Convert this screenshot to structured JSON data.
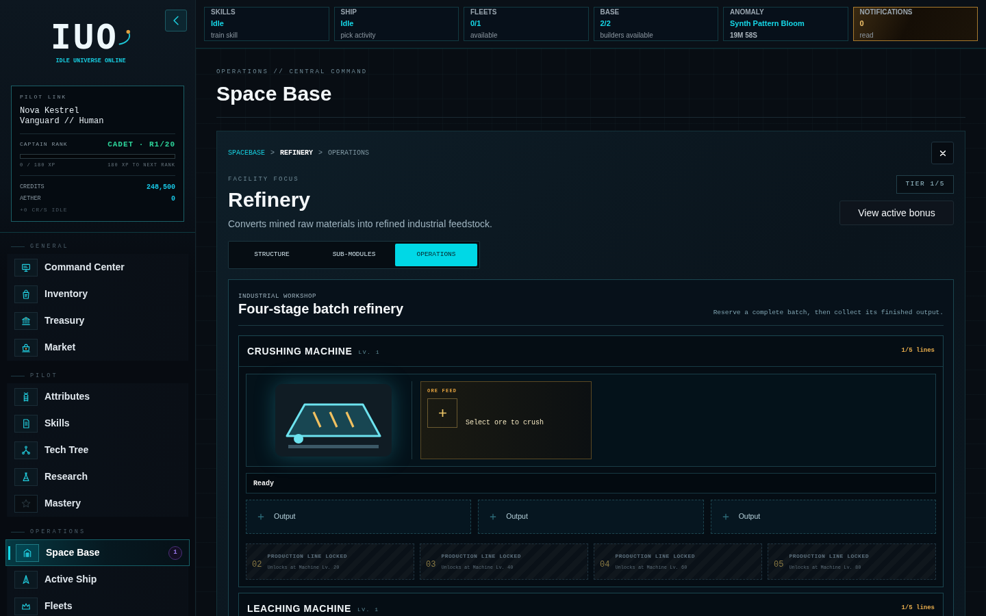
{
  "sidebar": {
    "logo": {
      "wordmark": "IUO",
      "tagline": "IDLE UNIVERSE ONLINE"
    },
    "pilot": {
      "label": "PILOT LINK",
      "name": "Nova Kestrel",
      "class": "Vanguard // Human",
      "rank_label": "CAPTAIN RANK",
      "rank": "CADET · R1/20",
      "xp": {
        "level": 0,
        "current": "0 / 180 XP",
        "remaining": "180 XP TO NEXT RANK"
      },
      "balances": [
        {
          "label": "CREDITS",
          "value": "248,500"
        },
        {
          "label": "AETHER",
          "value": "0"
        }
      ],
      "rate": "+0 CR/S IDLE"
    },
    "sections": [
      {
        "title": "GENERAL",
        "items": [
          {
            "label": "Command Center",
            "selected": false
          },
          {
            "label": "Inventory",
            "selected": false
          },
          {
            "label": "Treasury",
            "selected": false
          },
          {
            "label": "Market",
            "selected": false
          }
        ]
      },
      {
        "title": "PILOT",
        "items": [
          {
            "label": "Attributes",
            "selected": false
          },
          {
            "label": "Skills",
            "selected": false
          },
          {
            "label": "Tech Tree",
            "selected": false
          },
          {
            "label": "Research",
            "selected": false
          },
          {
            "label": "Mastery",
            "selected": false
          }
        ]
      },
      {
        "title": "OPERATIONS",
        "items": [
          {
            "label": "Space Base",
            "selected": true,
            "badge": "1"
          },
          {
            "label": "Active Ship",
            "selected": false
          },
          {
            "label": "Fleets",
            "selected": false
          }
        ]
      }
    ]
  },
  "status_bar": [
    {
      "label": "SKILLS",
      "value": "Idle",
      "note": "train skill",
      "kind": "standard"
    },
    {
      "label": "SHIP",
      "value": "Idle",
      "note": "pick activity",
      "kind": "standard"
    },
    {
      "label": "FLEETS",
      "value": "0/1",
      "note": "available",
      "kind": "standard"
    },
    {
      "label": "BASE",
      "value": "2/2",
      "note": "builders available",
      "kind": "standard"
    },
    {
      "label": "ANOMALY",
      "value": "Synth Pattern Bloom",
      "note": "19M 58S",
      "kind": "timer"
    },
    {
      "label": "NOTIFICATIONS",
      "value": "0",
      "note": "read",
      "kind": "alert"
    }
  ],
  "page": {
    "eyebrow": "OPERATIONS // CENTRAL COMMAND",
    "title": "Space Base"
  },
  "facility": {
    "breadcrumb": [
      {
        "label": "SPACEBASE",
        "kind": "link"
      },
      {
        "label": ">",
        "kind": "separator"
      },
      {
        "label": "REFINERY",
        "kind": "current"
      },
      {
        "label": ">",
        "kind": "separator"
      },
      {
        "label": "OPERATIONS",
        "kind": "trail"
      }
    ],
    "eyebrow": "FACILITY FOCUS",
    "title": "Refinery",
    "description": "Converts mined raw materials into refined industrial feedstock.",
    "tier": "TIER 1/5",
    "bonus_button": "View active bonus",
    "tabs": [
      {
        "label": "STRUCTURE",
        "selected": false
      },
      {
        "label": "SUB-MODULES",
        "selected": false
      },
      {
        "label": "OPERATIONS",
        "selected": true
      }
    ],
    "workshop": {
      "eyebrow": "INDUSTRIAL WORKSHOP",
      "title": "Four-stage batch refinery",
      "hint": "Reserve a complete batch, then collect its finished output.",
      "machines": [
        {
          "name": "CRUSHING MACHINE",
          "rank": "LV. 1",
          "lines": "1/5 lines",
          "feed": {
            "label": "ORE FEED",
            "prompt": "Select ore to crush"
          },
          "status": "Ready",
          "outputs": [
            "Output",
            "Output",
            "Output"
          ],
          "locked_lines": [
            {
              "number": "02",
              "title": "PRODUCTION LINE LOCKED",
              "note": "Unlocks at Machine Lv. 20"
            },
            {
              "number": "03",
              "title": "PRODUCTION LINE LOCKED",
              "note": "Unlocks at Machine Lv. 40"
            },
            {
              "number": "04",
              "title": "PRODUCTION LINE LOCKED",
              "note": "Unlocks at Machine Lv. 60"
            },
            {
              "number": "05",
              "title": "PRODUCTION LINE LOCKED",
              "note": "Unlocks at Machine Lv. 80"
            }
          ]
        },
        {
          "name": "LEACHING MACHINE",
          "rank": "LV. 1",
          "lines": "1/5 lines"
        }
      ]
    }
  }
}
